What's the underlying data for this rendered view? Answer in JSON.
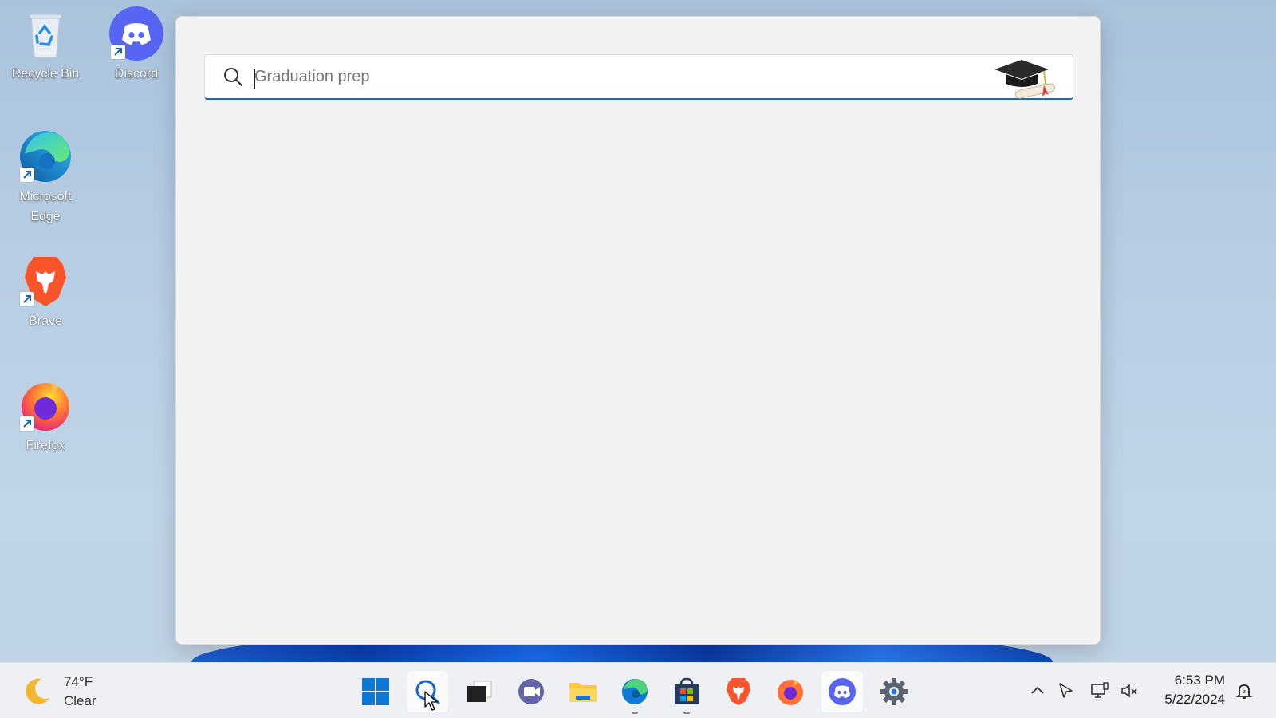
{
  "desktop": {
    "icons": [
      {
        "label": "Recycle Bin",
        "icon": "recycle-bin-icon"
      },
      {
        "label": "Discord",
        "icon": "discord-icon"
      },
      {
        "label": "Microsoft Edge",
        "icon": "edge-icon"
      },
      {
        "label": "Brave",
        "icon": "brave-icon"
      },
      {
        "label": "Firefox",
        "icon": "firefox-icon"
      }
    ]
  },
  "search": {
    "placeholder": "Graduation prep",
    "value": "",
    "icon": "search-icon",
    "hero_icon": "graduation-cap-icon"
  },
  "taskbar": {
    "weather": {
      "temp": "74°F",
      "condition": "Clear",
      "icon": "moon-icon"
    },
    "apps": [
      {
        "name": "Start",
        "icon": "windows-start-icon"
      },
      {
        "name": "Search",
        "icon": "search-icon",
        "active": true
      },
      {
        "name": "Task View",
        "icon": "task-view-icon"
      },
      {
        "name": "Teams Chat",
        "icon": "teams-chat-icon"
      },
      {
        "name": "File Explorer",
        "icon": "file-explorer-icon"
      },
      {
        "name": "Microsoft Edge",
        "icon": "edge-icon",
        "running": true
      },
      {
        "name": "Microsoft Store",
        "icon": "store-icon",
        "running": true
      },
      {
        "name": "Brave",
        "icon": "brave-icon"
      },
      {
        "name": "Firefox",
        "icon": "firefox-icon"
      },
      {
        "name": "Discord",
        "icon": "discord-icon",
        "active": true
      },
      {
        "name": "Settings",
        "icon": "settings-gear-icon"
      }
    ],
    "tray": [
      "chevron-up-icon",
      "location-arrow-icon",
      "network-icon",
      "volume-muted-icon"
    ],
    "clock": {
      "time": "6:53 PM",
      "date": "5/22/2024"
    },
    "notification_icon": "notification-bell-icon"
  },
  "colors": {
    "accent": "#1467c6",
    "discord": "#5865f2",
    "panel_bg": "#f2f2f2",
    "taskbar_bg": "#eef0f3"
  }
}
